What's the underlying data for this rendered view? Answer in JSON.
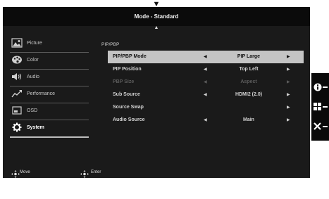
{
  "header": {
    "title": "Mode - Standard"
  },
  "sidebar": {
    "items": [
      {
        "label": "Picture",
        "icon": "picture-icon"
      },
      {
        "label": "Color",
        "icon": "palette-icon"
      },
      {
        "label": "Audio",
        "icon": "speaker-icon"
      },
      {
        "label": "Performance",
        "icon": "performance-icon"
      },
      {
        "label": "OSD",
        "icon": "osd-icon"
      },
      {
        "label": "System",
        "icon": "gear-icon",
        "active": true
      }
    ]
  },
  "main": {
    "section": "PIP/PBP",
    "rows": [
      {
        "name": "PIP/PBP Mode",
        "value": "PIP Large",
        "selected": true
      },
      {
        "name": "PIP Position",
        "value": "Top Left"
      },
      {
        "name": "PBP Size",
        "value": "Aspect",
        "disabled": true
      },
      {
        "name": "Sub Source",
        "value": "HDMI2 (2.0)"
      },
      {
        "name": "Source Swap",
        "value": ""
      },
      {
        "name": "Audio Source",
        "value": "Main"
      }
    ]
  },
  "footer": {
    "move_label": "Move",
    "enter_label": "Enter"
  },
  "side_panel": {
    "buttons": [
      "info-icon",
      "layout-icon",
      "close-icon"
    ]
  },
  "colors": {
    "background": "#1a1a1a",
    "header": "#0b0b0b",
    "selected_row": "#c4c4c4"
  }
}
